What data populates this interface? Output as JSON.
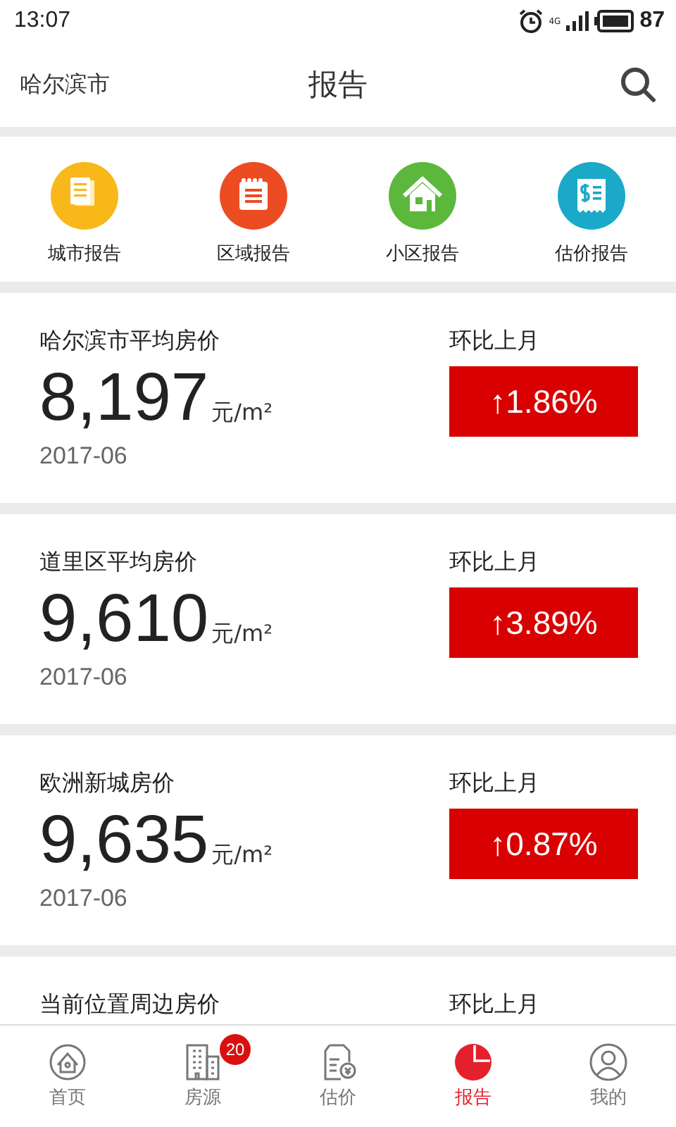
{
  "status_bar": {
    "time": "13:07",
    "network": "4G",
    "battery": "87"
  },
  "header": {
    "city": "哈尔滨市",
    "title": "报告"
  },
  "shortcuts": [
    {
      "kind": "document",
      "label": "城市报告",
      "color": "#f9b81a"
    },
    {
      "kind": "notepad",
      "label": "区域报告",
      "color": "#eb4c22"
    },
    {
      "kind": "house",
      "label": "小区报告",
      "color": "#5cb83c"
    },
    {
      "kind": "receipt",
      "label": "估价报告",
      "color": "#1aa9c9"
    }
  ],
  "reports": [
    {
      "title": "哈尔滨市平均房价",
      "price": "8,197",
      "unit": "元/m²",
      "date": "2017-06",
      "compare_label": "环比上月",
      "change": "↑1.86%"
    },
    {
      "title": "道里区平均房价",
      "price": "9,610",
      "unit": "元/m²",
      "date": "2017-06",
      "compare_label": "环比上月",
      "change": "↑3.89%"
    },
    {
      "title": "欧洲新城房价",
      "price": "9,635",
      "unit": "元/m²",
      "date": "2017-06",
      "compare_label": "环比上月",
      "change": "↑0.87%"
    },
    {
      "title": "当前位置周边房价",
      "compare_label": "环比上月"
    }
  ],
  "tab_bar": [
    {
      "kind": "home",
      "label": "首页",
      "selected": false
    },
    {
      "kind": "building",
      "label": "房源",
      "selected": false,
      "badge": "20"
    },
    {
      "kind": "valuation",
      "label": "估价",
      "selected": false
    },
    {
      "kind": "chart",
      "label": "报告",
      "selected": true
    },
    {
      "kind": "profile",
      "label": "我的",
      "selected": false
    }
  ]
}
